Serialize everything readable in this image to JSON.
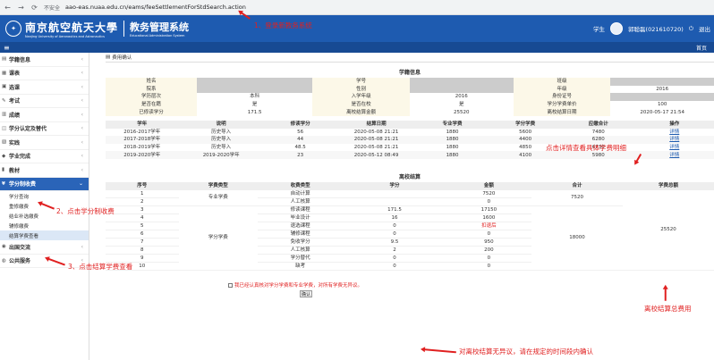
{
  "browser": {
    "insecure": "不安全",
    "url": "aao-eas.nuaa.edu.cn/eams/feeSettlementForStdSearch.action"
  },
  "header": {
    "school_cn": "南京航空航天大學",
    "school_en": "Nanjing University of Aeronautics and Astronautics",
    "system_cn": "教务管理系统",
    "system_en": "Educational Administration System",
    "role": "学生",
    "user": "郭聪磊(021610720)",
    "logout": "退出"
  },
  "toolbar": {
    "home": "首页"
  },
  "sidebar": {
    "items": [
      {
        "label": "学籍信息"
      },
      {
        "label": "课表"
      },
      {
        "label": "选课"
      },
      {
        "label": "考试"
      },
      {
        "label": "成绩"
      },
      {
        "label": "学分认定及替代"
      },
      {
        "label": "实践"
      },
      {
        "label": "学业完成"
      },
      {
        "label": "教材"
      },
      {
        "label": "学分制收费"
      },
      {
        "label": "出国交流"
      },
      {
        "label": "公共服务"
      }
    ],
    "subitems": [
      {
        "label": "学分查询"
      },
      {
        "label": "重修缴费"
      },
      {
        "label": "结业补选缴费"
      },
      {
        "label": "辅修缴费"
      },
      {
        "label": "结算学费查看"
      }
    ]
  },
  "breadcrumb": "费用确认",
  "info": {
    "title": "学籍信息",
    "rows": [
      [
        "姓名",
        "",
        "学号",
        "",
        "班级",
        ""
      ],
      [
        "院系",
        "",
        "性别",
        "",
        "年级",
        "2016"
      ],
      [
        "学历层次",
        "本科",
        "入学年级",
        "2016",
        "身份证号",
        ""
      ],
      [
        "是否在籍",
        "是",
        "是否在校",
        "是",
        "学分学费单价",
        "100"
      ],
      [
        "已修读学分",
        "171.5",
        "离校结算金额",
        "25520",
        "离校结算日期",
        "2020-05-17 21:54"
      ]
    ]
  },
  "years": {
    "headers": [
      "学年",
      "说明",
      "修读学分",
      "结算日期",
      "专业学费",
      "学分学费",
      "应缴合计",
      "操作"
    ],
    "rows": [
      [
        "2016-2017学年",
        "历史导入",
        "56",
        "2020-05-08 21:21",
        "1880",
        "5600",
        "7480",
        "详情"
      ],
      [
        "2017-2018学年",
        "历史导入",
        "44",
        "2020-05-08 21:21",
        "1880",
        "4400",
        "6280",
        "详情"
      ],
      [
        "2018-2019学年",
        "历史导入",
        "48.5",
        "2020-05-08 21:21",
        "1880",
        "4850",
        "6730",
        "详情"
      ],
      [
        "2019-2020学年",
        "2019-2020学年",
        "23",
        "2020-05-12 08:49",
        "1880",
        "4100",
        "5980",
        "详情"
      ]
    ]
  },
  "settle": {
    "title": "离校结算",
    "headers": [
      "序号",
      "学费类型",
      "收费类型",
      "学分",
      "金额",
      "合计",
      "学费总额"
    ],
    "group1": "专业学费",
    "group2": "学分学费",
    "total1": "7520",
    "total2": "18000",
    "grand": "25520",
    "rows": [
      [
        "1",
        "自动计算",
        "",
        "7520"
      ],
      [
        "2",
        "人工核算",
        "",
        "0"
      ],
      [
        "3",
        "修读课程",
        "171.5",
        "17150"
      ],
      [
        "4",
        "毕业设计",
        "16",
        "1600"
      ],
      [
        "5",
        "退选课程",
        "0",
        "扣退后"
      ],
      [
        "6",
        "辅修课程",
        "0",
        "0"
      ],
      [
        "7",
        "免收学分",
        "9.5",
        "950"
      ],
      [
        "8",
        "人工核算",
        "2",
        "200"
      ],
      [
        "9",
        "学分替代",
        "0",
        "0"
      ],
      [
        "10",
        "缺考",
        "0",
        "0"
      ]
    ]
  },
  "confirm": {
    "text": "我已经认真核对学分学费和专业学费，对所有学费无异议。",
    "button": "确认"
  },
  "annotations": {
    "a1": "1、登录新教务系统",
    "a2": "2、点击学分制收费",
    "a3": "3、点击结算学费查看",
    "a4": "点击详情查看具体学费明细",
    "a5": "离校结算总费用",
    "a6": "对离校结算无异议，请在规定的时间段内确认"
  },
  "colors": {
    "header": "#1e5bb0",
    "accent": "#2a64b8",
    "annotation": "#e02020"
  }
}
